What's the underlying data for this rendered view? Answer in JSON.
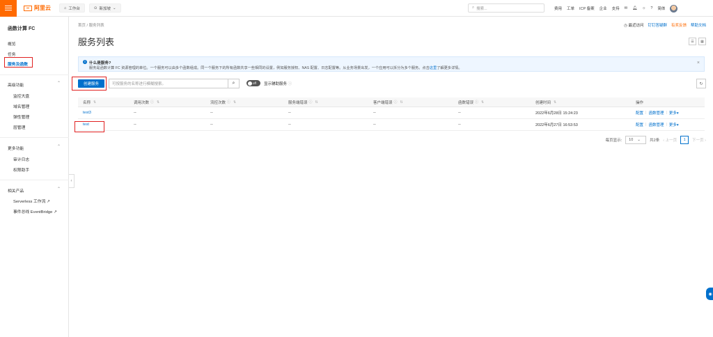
{
  "topbar": {
    "logo_text": "阿里云",
    "workbench": "工作台",
    "region": "新加坡",
    "search_placeholder": "搜索...",
    "links": [
      "费用",
      "工单",
      "ICP 备案",
      "企业",
      "支持"
    ],
    "lang": "简体"
  },
  "sidebar": {
    "title": "函数计算 FC",
    "items": [
      "概览",
      "任务",
      "服务及函数"
    ],
    "groups": [
      {
        "label": "高级功能",
        "items": [
          "监控大盘",
          "域名管理",
          "弹性管理",
          "层管理"
        ]
      },
      {
        "label": "更多功能",
        "items": [
          "审计日志",
          "权限助手"
        ]
      },
      {
        "label": "相关产品",
        "items": [
          "Serverless 工作流",
          "事件总线 EventBridge"
        ]
      }
    ]
  },
  "header": {
    "breadcrumb": [
      "首页",
      "服务列表"
    ],
    "title": "服务列表",
    "recent": "最近访问",
    "dingtalk": "钉钉答疑群",
    "feedback": "有奖反馈",
    "docs": "帮助文档"
  },
  "info": {
    "title": "什么是服务?",
    "text": "服务是函数计算 FC 资源管理的单位。一个服务可以由多个函数组成。同一个服务下的所有函数共享一些相同的设置，例如服务授权、NAS 配置、日志配置等。从业务场景出发，一个应用可以拆分为多个服务。点击",
    "link": "这里",
    "tail": "了解更多详情。"
  },
  "toolbar": {
    "create_label": "创建服务",
    "filter_placeholder": "可按服务的名称进行模糊搜索。",
    "toggle_state": "off",
    "toggle_label": "显示辅助服务"
  },
  "table": {
    "columns": [
      "名称",
      "调用次数",
      "流控次数",
      "服务端错误",
      "客户端错误",
      "函数错误",
      "创建时间",
      "操作"
    ],
    "rows": [
      {
        "name": "test3",
        "calls": "--",
        "throttles": "--",
        "server_errors": "--",
        "client_errors": "--",
        "function_errors": "--",
        "created": "2022年6月28日 15:24:23"
      },
      {
        "name": "test",
        "calls": "--",
        "throttles": "--",
        "server_errors": "--",
        "client_errors": "--",
        "function_errors": "--",
        "created": "2022年6月27日 16:53:53"
      }
    ],
    "actions": [
      "配置",
      "函数管理",
      "更多"
    ]
  },
  "pager": {
    "per_page_label": "每页显示:",
    "per_page": "10",
    "total": "共2条",
    "prev": "上一页",
    "page": "1",
    "next": "下一页"
  },
  "colors": {
    "brand": "#ff6a00",
    "primary": "#0070cc",
    "highlight": "#e02020"
  }
}
